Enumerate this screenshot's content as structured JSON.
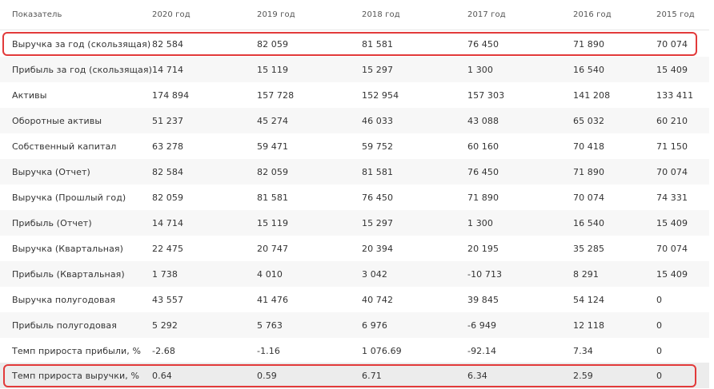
{
  "header": [
    "Показатель",
    "2020 год",
    "2019 год",
    "2018 год",
    "2017 год",
    "2016 год",
    "2015 год"
  ],
  "rows": [
    [
      "Выручка за год (скользящая)",
      "82 584",
      "82 059",
      "81 581",
      "76 450",
      "71 890",
      "70 074"
    ],
    [
      "Прибыль за год (скользящая)",
      "14 714",
      "15 119",
      "15 297",
      "1 300",
      "16 540",
      "15 409"
    ],
    [
      "Активы",
      "174 894",
      "157 728",
      "152 954",
      "157 303",
      "141 208",
      "133 411"
    ],
    [
      "Оборотные активы",
      "51 237",
      "45 274",
      "46 033",
      "43 088",
      "65 032",
      "60 210"
    ],
    [
      "Собственный капитал",
      "63 278",
      "59 471",
      "59 752",
      "60 160",
      "70 418",
      "71 150"
    ],
    [
      "Выручка (Отчет)",
      "82 584",
      "82 059",
      "81 581",
      "76 450",
      "71 890",
      "70 074"
    ],
    [
      "Выручка (Прошлый год)",
      "82 059",
      "81 581",
      "76 450",
      "71 890",
      "70 074",
      "74 331"
    ],
    [
      "Прибыль (Отчет)",
      "14 714",
      "15 119",
      "15 297",
      "1 300",
      "16 540",
      "15 409"
    ],
    [
      "Выручка (Квартальная)",
      "22 475",
      "20 747",
      "20 394",
      "20 195",
      "35 285",
      "70 074"
    ],
    [
      "Прибыль (Квартальная)",
      "1 738",
      "4 010",
      "3 042",
      "-10 713",
      "8 291",
      "15 409"
    ],
    [
      "Выручка полугодовая",
      "43 557",
      "41 476",
      "40 742",
      "39 845",
      "54 124",
      "0"
    ],
    [
      "Прибыль полугодовая",
      "5 292",
      "5 763",
      "6 976",
      "-6 949",
      "12 118",
      "0"
    ],
    [
      "Темп прироста прибыли, %",
      "-2.68",
      "-1.16",
      "1 076.69",
      "-92.14",
      "7.34",
      "0"
    ],
    [
      "Темп прироста выручки, %",
      "0.64",
      "0.59",
      "6.71",
      "6.34",
      "2.59",
      "0"
    ]
  ],
  "highlight_color": "#e23a3a"
}
